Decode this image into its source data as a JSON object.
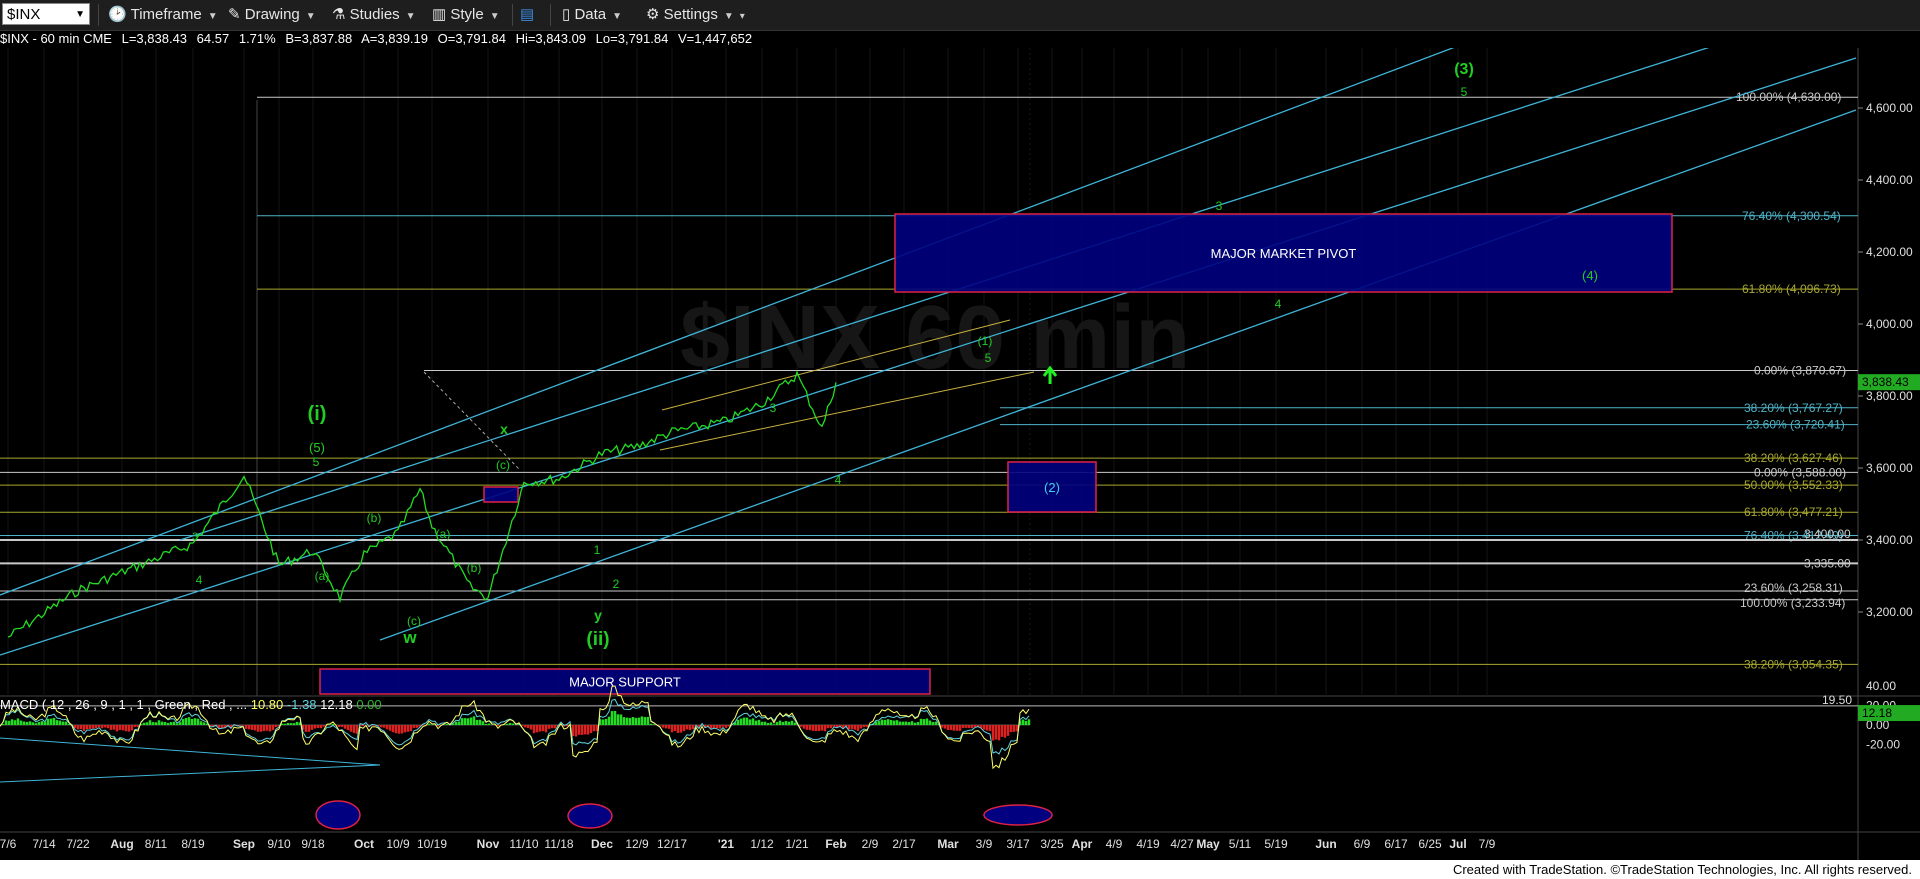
{
  "toolbar": {
    "symbol": "$INX",
    "timeframe_label": "Timeframe",
    "drawing_label": "Drawing",
    "studies_label": "Studies",
    "style_label": "Style",
    "data_label": "Data",
    "settings_label": "Settings"
  },
  "quote": {
    "title": "$INX - 60 min CME",
    "last": "L=3,838.43",
    "change": "64.57",
    "pct": "1.71%",
    "bid": "B=3,837.88",
    "ask": "A=3,839.19",
    "open": "O=3,791.84",
    "high": "Hi=3,843.09",
    "low": "Lo=3,791.84",
    "volume": "V=1,447,652"
  },
  "macd_header": {
    "label": "MACD ( 12 , 26 , 9 , 1 , 1 , Green , Red , ...",
    "v1": "10.80",
    "v2": "-1.38",
    "v3": "12.18",
    "v4": "0.00"
  },
  "footer": "Created with TradeStation. ©TradeStation Technologies, Inc. All rights reserved.",
  "watermark": "$INX 60 min",
  "colors": {
    "price": "#22dd22",
    "fib_main": "#c9c9c9",
    "fib_teal": "#4fb4c8",
    "fib_olive": "#a8a830",
    "channel": "#3fb4d8",
    "zone_fill": "#000080",
    "zone_border": "#dd2244",
    "wave_label": "#22cc22",
    "macd_pos": "#22dd22",
    "macd_neg": "#dd2222"
  },
  "chart_data": {
    "type": "line",
    "symbol": "$INX",
    "timeframe": "60 min",
    "price_axis": {
      "ylim": [
        3000,
        4750
      ],
      "ticks": [
        "3,200.00",
        "3,400.00",
        "3,600.00",
        "3,800.00",
        "4,000.00",
        "4,200.00",
        "4,400.00",
        "4,600.00"
      ],
      "tick_values": [
        3200,
        3400,
        3600,
        3800,
        4000,
        4200,
        4400,
        4600
      ],
      "last_price_tag": "3,838.43",
      "last_price": 3838.43
    },
    "x_tick_labels": [
      "7/6",
      "7/14",
      "7/22",
      "Aug",
      "8/11",
      "8/19",
      "Sep",
      "9/10",
      "9/18",
      "Oct",
      "10/9",
      "10/19",
      "Nov",
      "11/10",
      "11/18",
      "Dec",
      "12/9",
      "12/17",
      "'21",
      "1/12",
      "1/21",
      "Feb",
      "2/9",
      "2/17",
      "Mar",
      "3/9",
      "3/17",
      "3/25",
      "Apr",
      "4/9",
      "4/19",
      "4/27",
      "May",
      "5/11",
      "5/19",
      "Jun",
      "6/9",
      "6/17",
      "6/25",
      "Jul",
      "7/9"
    ],
    "price_series": {
      "name": "$INX",
      "dates": [
        "7/6",
        "7/22",
        "Aug",
        "8/19",
        "Sep",
        "9/10",
        "9/18",
        "9/24",
        "Oct",
        "10/9",
        "10/12",
        "10/19",
        "10/30",
        "Nov",
        "11/10",
        "11/18",
        "Dec",
        "12/9",
        "12/17",
        "'21",
        "1/12",
        "1/21",
        "1/29",
        "Feb"
      ],
      "values": [
        3130,
        3260,
        3310,
        3390,
        3580,
        3330,
        3370,
        3240,
        3360,
        3420,
        3540,
        3440,
        3270,
        3240,
        3560,
        3570,
        3640,
        3660,
        3700,
        3730,
        3780,
        3860,
        3710,
        3838
      ]
    },
    "fib_levels": [
      {
        "label": "100.00% (4,630.00)",
        "value": 4630
      },
      {
        "label": "76.40% (4,300.54)",
        "value": 4300.54
      },
      {
        "label": "61.80% (4,096.73)",
        "value": 4096.73
      },
      {
        "label": "0.00% (3,870.67)",
        "value": 3870.67
      },
      {
        "label": "38.20% (3,767.27)",
        "value": 3767.27
      },
      {
        "label": "23.60% (3,720.41)",
        "value": 3720.41
      },
      {
        "label": "38.20% (3,627.46)",
        "value": 3627.46
      },
      {
        "label": "0.00% (3,588.00)",
        "value": 3588
      },
      {
        "label": "50.00% (3,552.33)",
        "value": 3552.33
      },
      {
        "label": "61.80% (3,477.21)",
        "value": 3477.21
      },
      {
        "label": "76.40% (3,412.49)",
        "value": 3412.49
      },
      {
        "label": "3,400.00",
        "value": 3400
      },
      {
        "label": "3,335.00",
        "value": 3335
      },
      {
        "label": "23.60% (3,258.31)",
        "value": 3258.31
      },
      {
        "label": "100.00% (3,233.94)",
        "value": 3233.94
      },
      {
        "label": "38.20% (3,054.35)",
        "value": 3054.35
      }
    ],
    "zones": [
      {
        "label": "MAJOR MARKET PIVOT",
        "y_range": [
          4100,
          4310
        ],
        "x_range": [
          "'21",
          "Jun"
        ]
      },
      {
        "label": "(2)",
        "y_range": [
          3480,
          3620
        ],
        "x_range": [
          "1/29",
          "2/9"
        ]
      },
      {
        "label": "MAJOR SUPPORT",
        "y_range": [
          3000,
          3075
        ],
        "x_range": [
          "9/5",
          "1/21"
        ]
      },
      {
        "label": "",
        "y_range": [
          3545,
          3590
        ],
        "x_range": [
          "10/9",
          "10/12"
        ]
      }
    ],
    "wave_labels": [
      "(3)",
      "5",
      "3",
      "(4)",
      "4",
      "(1)",
      "5",
      "3",
      "4",
      "(i)",
      "(5)",
      "5",
      "3",
      "4",
      "(a)",
      "(b)",
      "(c)",
      "w",
      "x",
      "(c)",
      "(a)",
      "(b)",
      "1",
      "2",
      "y",
      "(ii)",
      "(2)"
    ],
    "macd": {
      "params": "12 , 26 , 9 , 1 , 1 , Green , Red",
      "ticks": [
        "40.00",
        "20.00",
        "0.00",
        "-20.00"
      ],
      "tick_values": [
        40,
        20,
        0,
        -20
      ],
      "level_label": "19.50",
      "level": 19.5,
      "last_value": "12.18"
    }
  }
}
